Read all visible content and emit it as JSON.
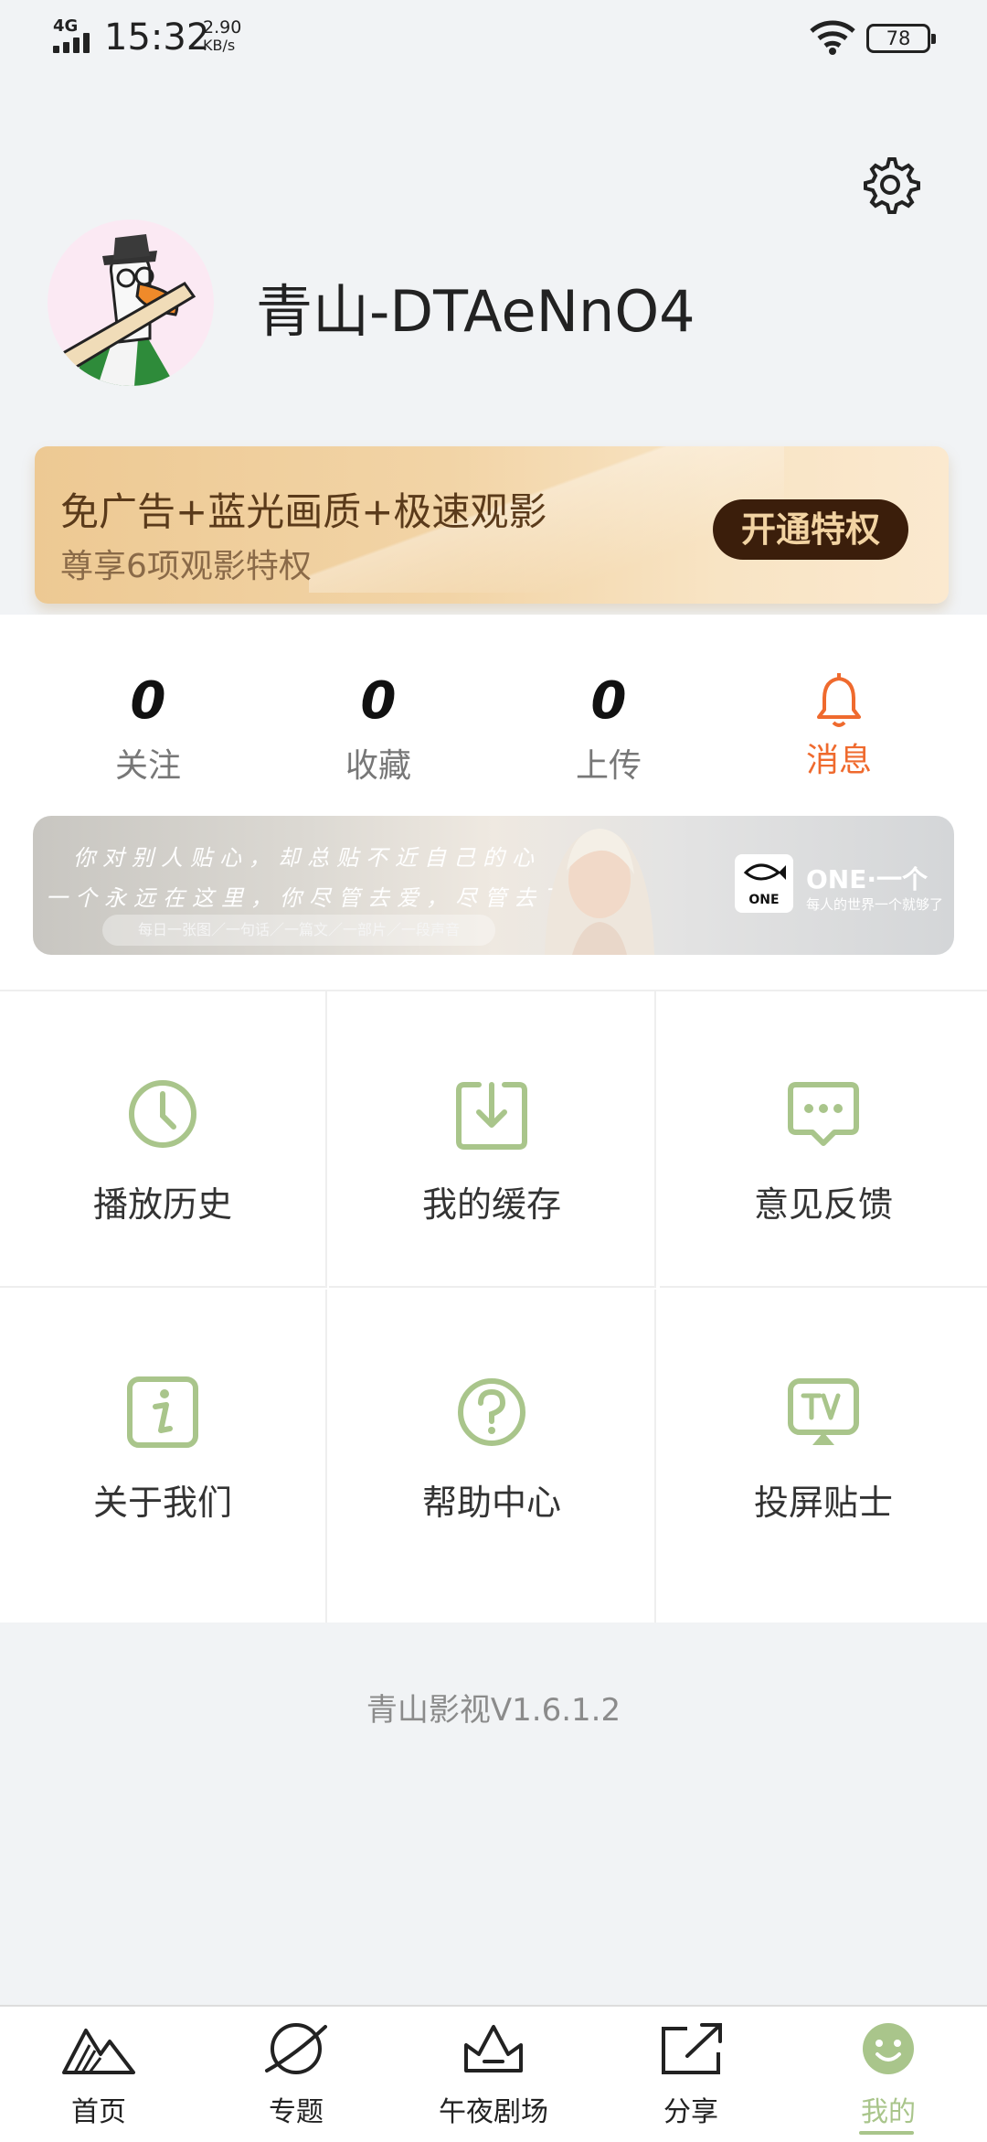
{
  "status_bar": {
    "network": "4G",
    "time": "15:32",
    "speed_value": "2.90",
    "speed_unit": "KB/s",
    "battery": "78"
  },
  "profile": {
    "username": "青山-DTAeNnO4",
    "settings_icon": "gear-icon",
    "avatar_icon": "goose-avatar"
  },
  "vip": {
    "title": "免广告+蓝光画质+极速观影",
    "subtitle": "尊享6项观影特权",
    "button": "开通特权"
  },
  "stats": {
    "items": [
      {
        "value": "0",
        "label": "关注"
      },
      {
        "value": "0",
        "label": "收藏"
      },
      {
        "value": "0",
        "label": "上传"
      },
      {
        "label": "消息",
        "icon": "bell-icon",
        "color": "#ef6a2e"
      }
    ]
  },
  "ad": {
    "line1": "你对别人贴心，却总贴不近自己的心",
    "line2": "一个永远在这里，你尽管去爱，尽管去飞",
    "pill": "每日一张图／一句话／一篇文／一部片／一段声音",
    "logo_text": "ONE",
    "brand": "ONE·一个",
    "brand_sub": "每人的世界一个就够了"
  },
  "menu": {
    "items": [
      {
        "label": "播放历史",
        "icon": "clock-icon"
      },
      {
        "label": "我的缓存",
        "icon": "download-icon"
      },
      {
        "label": "意见反馈",
        "icon": "chat-icon"
      },
      {
        "label": "关于我们",
        "icon": "info-icon"
      },
      {
        "label": "帮助中心",
        "icon": "help-icon"
      },
      {
        "label": "投屏贴士",
        "icon": "tv-icon"
      }
    ],
    "icon_color": "#a9c58b"
  },
  "version": "青山影视V1.6.1.2",
  "bottom_nav": {
    "items": [
      {
        "label": "首页",
        "icon": "mountain-icon"
      },
      {
        "label": "专题",
        "icon": "planet-icon"
      },
      {
        "label": "午夜剧场",
        "icon": "crown-icon"
      },
      {
        "label": "分享",
        "icon": "share-icon"
      },
      {
        "label": "我的",
        "icon": "smile-icon",
        "active": true
      }
    ],
    "active_color": "#a9c58b"
  }
}
